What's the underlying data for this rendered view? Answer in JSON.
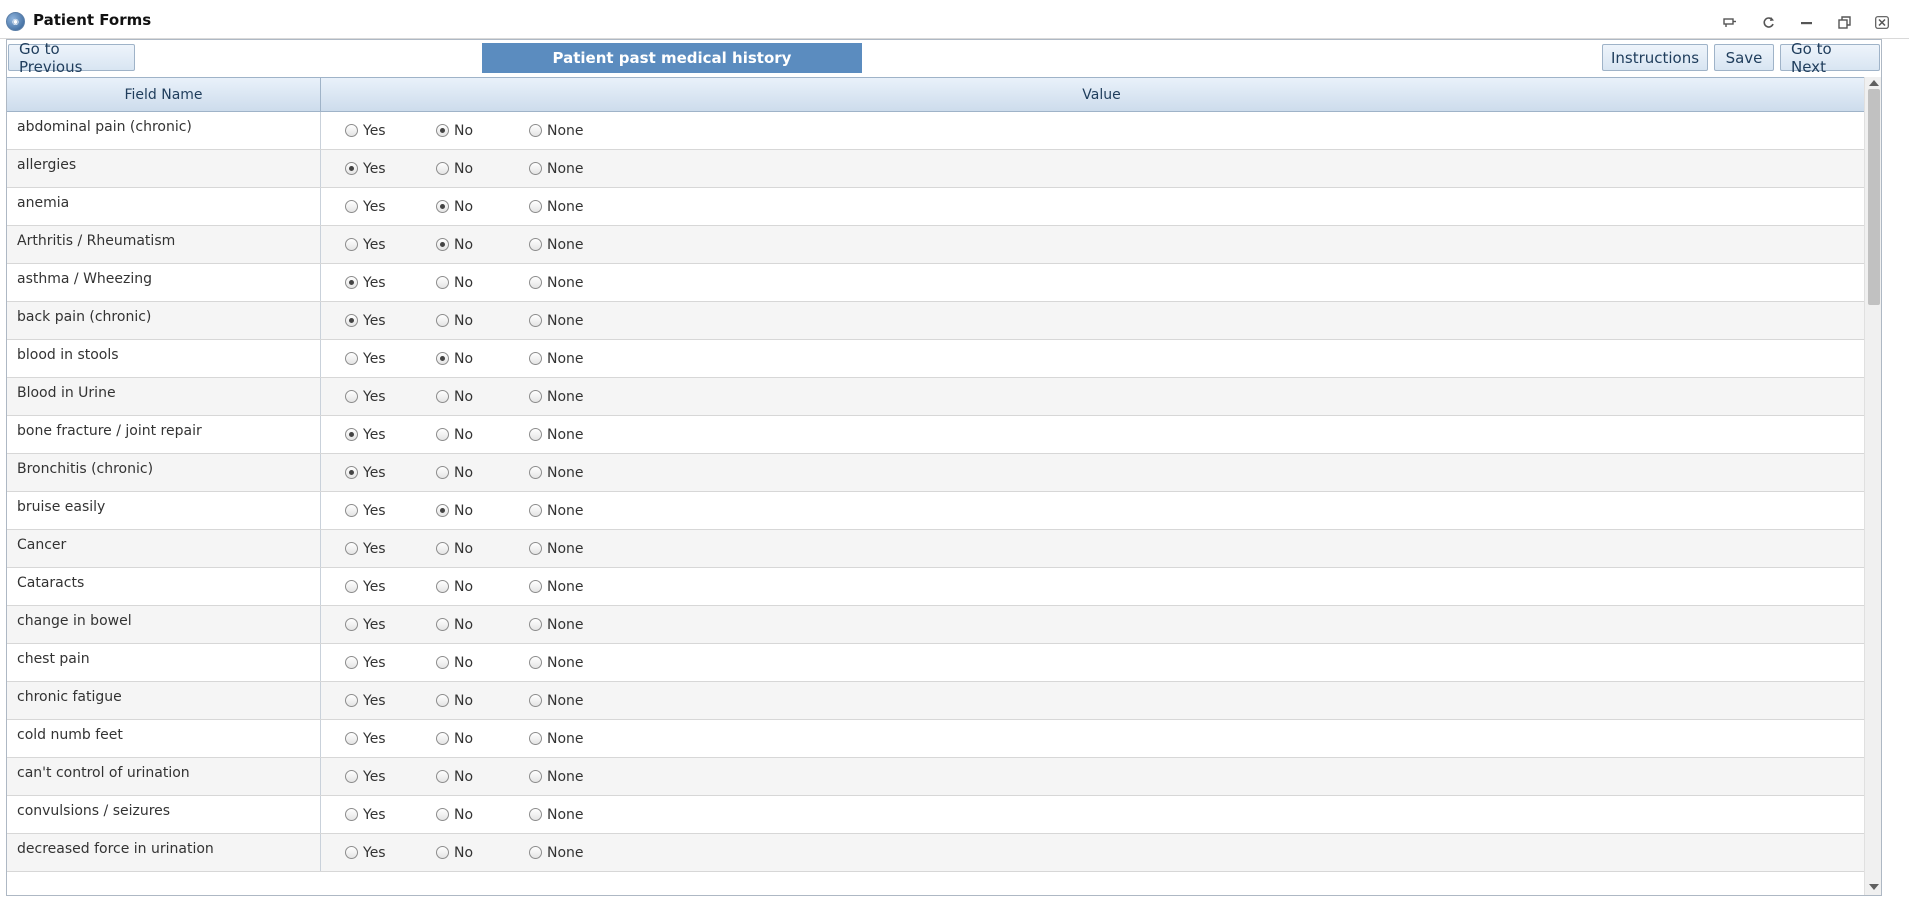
{
  "window": {
    "title": "Patient Forms",
    "icon": "app-logo-icon"
  },
  "toolbar": {
    "previous_label": "Go to Previous",
    "form_title": "Patient past medical history",
    "instructions_label": "Instructions",
    "save_label": "Save",
    "next_label": "Go to Next"
  },
  "grid": {
    "columns": {
      "field_name": "Field Name",
      "value": "Value"
    },
    "option_labels": {
      "yes": "Yes",
      "no": "No",
      "none": "None"
    },
    "rows": [
      {
        "name": "abdominal pain (chronic)",
        "selected": "no"
      },
      {
        "name": "allergies",
        "selected": "yes"
      },
      {
        "name": "anemia",
        "selected": "no"
      },
      {
        "name": "Arthritis / Rheumatism",
        "selected": "no"
      },
      {
        "name": "asthma / Wheezing",
        "selected": "yes"
      },
      {
        "name": "back pain (chronic)",
        "selected": "yes"
      },
      {
        "name": "blood in stools",
        "selected": "no"
      },
      {
        "name": "Blood in Urine",
        "selected": ""
      },
      {
        "name": "bone fracture / joint repair",
        "selected": "yes"
      },
      {
        "name": "Bronchitis (chronic)",
        "selected": "yes"
      },
      {
        "name": "bruise easily",
        "selected": "no"
      },
      {
        "name": "Cancer",
        "selected": ""
      },
      {
        "name": "Cataracts",
        "selected": ""
      },
      {
        "name": "change in bowel",
        "selected": ""
      },
      {
        "name": "chest pain",
        "selected": ""
      },
      {
        "name": "chronic fatigue",
        "selected": ""
      },
      {
        "name": "cold numb feet",
        "selected": ""
      },
      {
        "name": "can't control of urination",
        "selected": ""
      },
      {
        "name": "convulsions / seizures",
        "selected": ""
      },
      {
        "name": "decreased force in urination",
        "selected": ""
      }
    ]
  },
  "colors": {
    "title_band": "#5b8cbf",
    "header_border": "#9fb3c8",
    "button_text": "#1f3d5c"
  }
}
